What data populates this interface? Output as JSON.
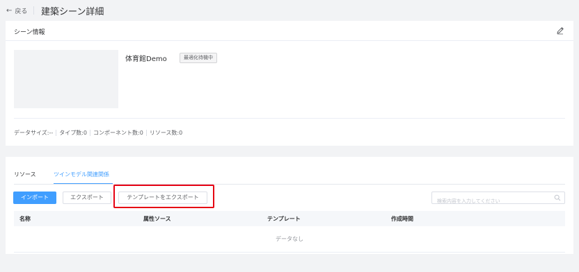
{
  "header": {
    "back_arrow": "←",
    "back_label": "戻る",
    "title": "建築シーン詳細"
  },
  "scene_info": {
    "section_title": "シーン情報",
    "edit_icon": "pencil-icon",
    "name": "体育館Demo",
    "badge": "最適化待機中",
    "stats": [
      "データサイズ:--",
      "タイプ数:0",
      "コンポーネント数:0",
      "リソース数:0"
    ]
  },
  "tabs": [
    {
      "label": "リソース",
      "active": false
    },
    {
      "label": "ツインモデル関連関係",
      "active": true
    }
  ],
  "toolbar": {
    "import_label": "インポート",
    "export_label": "エクスポート",
    "template_export_label": "テンプレートをエクスポート"
  },
  "search": {
    "placeholder": "検索内容を入力してください",
    "value": ""
  },
  "table": {
    "columns": [
      "名称",
      "属性ソース",
      "テンプレート",
      "作成時間"
    ],
    "empty_text": "データなし"
  },
  "colors": {
    "primary": "#409eff",
    "highlight": "#e60012",
    "background": "#f2f3f5"
  }
}
